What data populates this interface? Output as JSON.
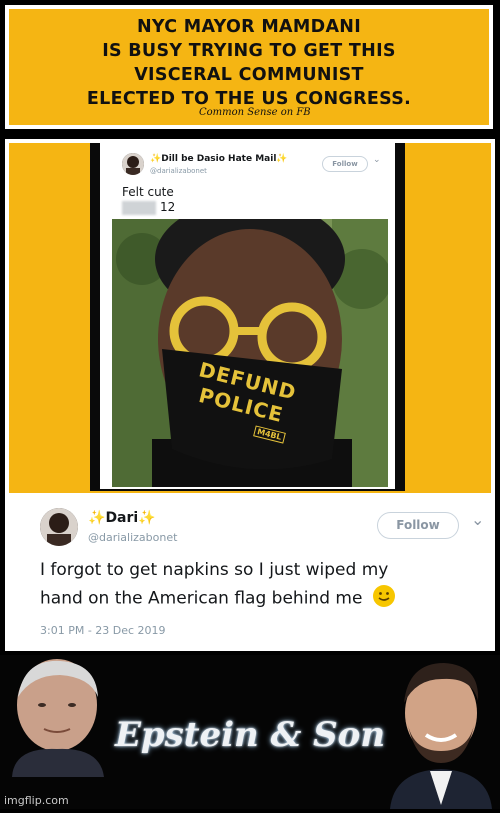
{
  "banner": {
    "lines": [
      "NYC MAYOR MAMDANI",
      "IS BUSY TRYING TO GET THIS",
      "VISCERAL COMMUNIST",
      "ELECTED TO THE US CONGRESS."
    ],
    "credit": "Common Sense on FB",
    "background_color": "#f5b513"
  },
  "tweet_top": {
    "display_name": "Dill be Dasio Hate Mail",
    "handle": "@darializabonet",
    "follow_label": "Follow",
    "text_line1": "Felt cute",
    "text_line2": "12",
    "mask_text_line1": "DEFUND",
    "mask_text_line2": "POLICE",
    "mask_tag": "M4BL"
  },
  "tweet_bottom": {
    "display_name": "Dari",
    "handle": "@darializabonet",
    "follow_label": "Follow",
    "text_line1": "I forgot to get napkins so I just wiped my",
    "text_line2": "hand on the American flag behind me",
    "timestamp": "3:01 PM - 23 Dec 2019"
  },
  "bottom": {
    "caption": "Epstein & Son",
    "watermark": "imgflip.com"
  }
}
